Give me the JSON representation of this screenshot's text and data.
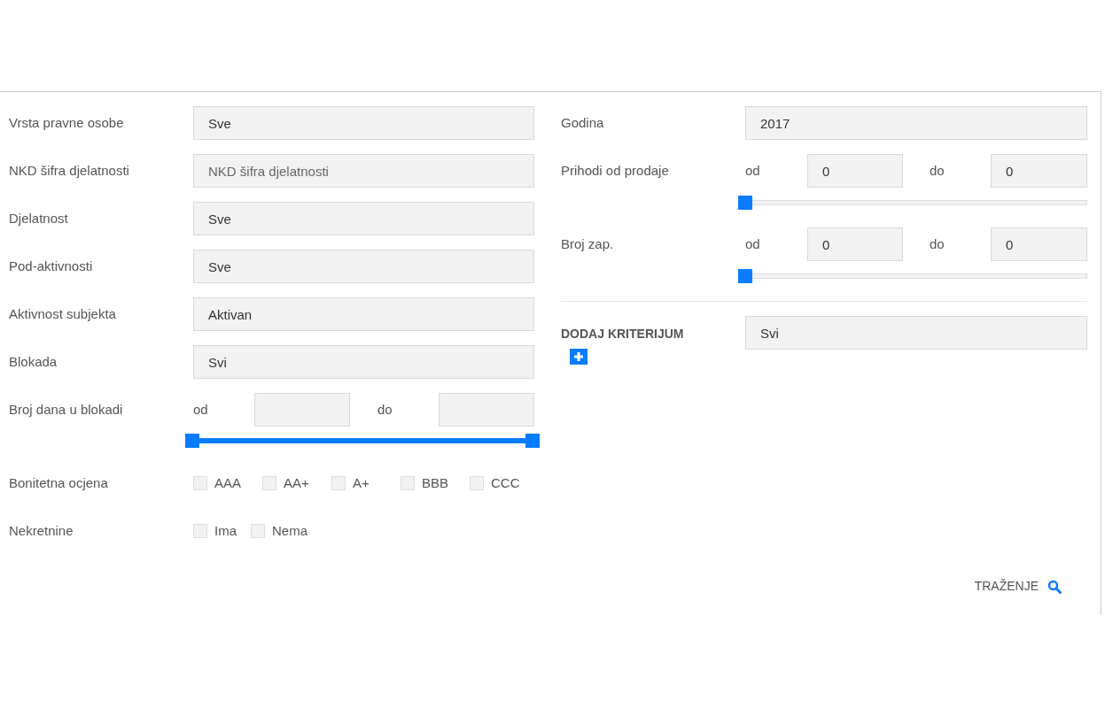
{
  "left": {
    "fields": [
      {
        "label": "Vrsta pravne osobe",
        "value": "Sve"
      },
      {
        "label": "NKD šifra djelatnosti",
        "placeholder": "NKD šifra djelatnosti"
      },
      {
        "label": "Djelatnost",
        "value": "Sve"
      },
      {
        "label": "Pod-aktivnosti",
        "value": "Sve"
      },
      {
        "label": "Aktivnost subjekta",
        "value": "Aktivan"
      },
      {
        "label": "Blokada",
        "value": "Svi"
      }
    ],
    "range": {
      "label": "Broj dana u blokadi",
      "from_label": "od",
      "to_label": "do",
      "slider": {
        "thumbs": [
          {
            "level": 0
          },
          {
            "level": 1
          }
        ]
      }
    },
    "checkbox_groups": [
      {
        "label": "Bonitetna ocjena",
        "options": [
          {
            "label": "AAA",
            "checked": false
          },
          {
            "label": "AA+",
            "checked": false
          },
          {
            "label": "A+",
            "checked": false
          },
          {
            "label": "BBB",
            "checked": false
          },
          {
            "label": "CCC",
            "checked": false
          }
        ]
      },
      {
        "label": "Nekretnine",
        "options": [
          {
            "label": "Ima",
            "checked": false
          },
          {
            "label": "Nema",
            "checked": false
          }
        ]
      }
    ]
  },
  "right": {
    "year": {
      "label": "Godina",
      "value": "2017"
    },
    "ranges": [
      {
        "label": "Prihodi od prodaje",
        "from_label": "od",
        "from_value": "0",
        "to_label": "do",
        "to_value": "0",
        "slider": {
          "thumbs": [
            {
              "level": 0
            }
          ]
        }
      },
      {
        "label": "Broj zap.",
        "from_label": "od",
        "from_value": "0",
        "to_label": "do",
        "to_value": "0",
        "slider": {
          "thumbs": [
            {
              "level": 0
            }
          ]
        }
      }
    ],
    "criterion": {
      "label": "DODAJ KRITERIJUM",
      "value": "Svi"
    }
  },
  "search_button": {
    "label": "TRAŽENJE"
  }
}
